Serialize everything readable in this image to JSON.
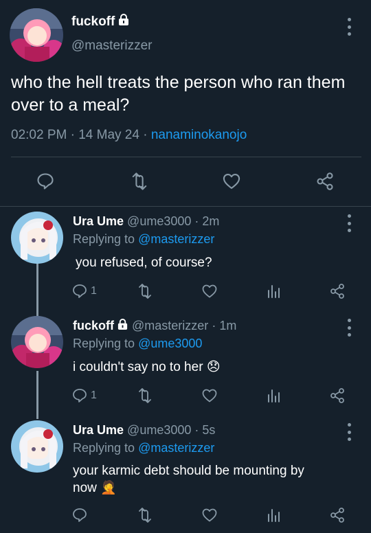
{
  "main_tweet": {
    "display_name": "fuckoff",
    "handle": "@masterizzer",
    "text": "who the hell treats the person who ran them over to a meal?",
    "time": "02:02 PM",
    "sep1": "·",
    "date": "14 May 24",
    "sep2": "·",
    "source": "nanaminokanojo",
    "icons": [
      "reply-icon",
      "retweet-icon",
      "like-icon",
      "share-icon"
    ]
  },
  "replies": [
    {
      "display_name": "Ura Ume",
      "handle": "@ume3000",
      "sep": "·",
      "time": "2m",
      "replying_prefix": "Replying to",
      "replying_handle": "@masterizzer",
      "text": "you refused, of course?",
      "reply_count": "1"
    },
    {
      "display_name": "fuckoff",
      "handle": "@masterizzer",
      "sep": "·",
      "time": "1m",
      "replying_prefix": "Replying to",
      "replying_handle": "@ume3000",
      "text": "i couldn't say no to her",
      "emoji": "😞",
      "reply_count": "1"
    },
    {
      "display_name": "Ura Ume",
      "handle": "@ume3000",
      "sep": "·",
      "time": "5s",
      "replying_prefix": "Replying to",
      "replying_handle": "@masterizzer",
      "text_line1": "your karmic debt should be mounting by",
      "text_line2": "now",
      "emoji": "🤦"
    }
  ],
  "colors": {
    "background": "#15202b",
    "muted": "#8899a6",
    "link": "#1d9bf0",
    "divider": "#38444d"
  }
}
